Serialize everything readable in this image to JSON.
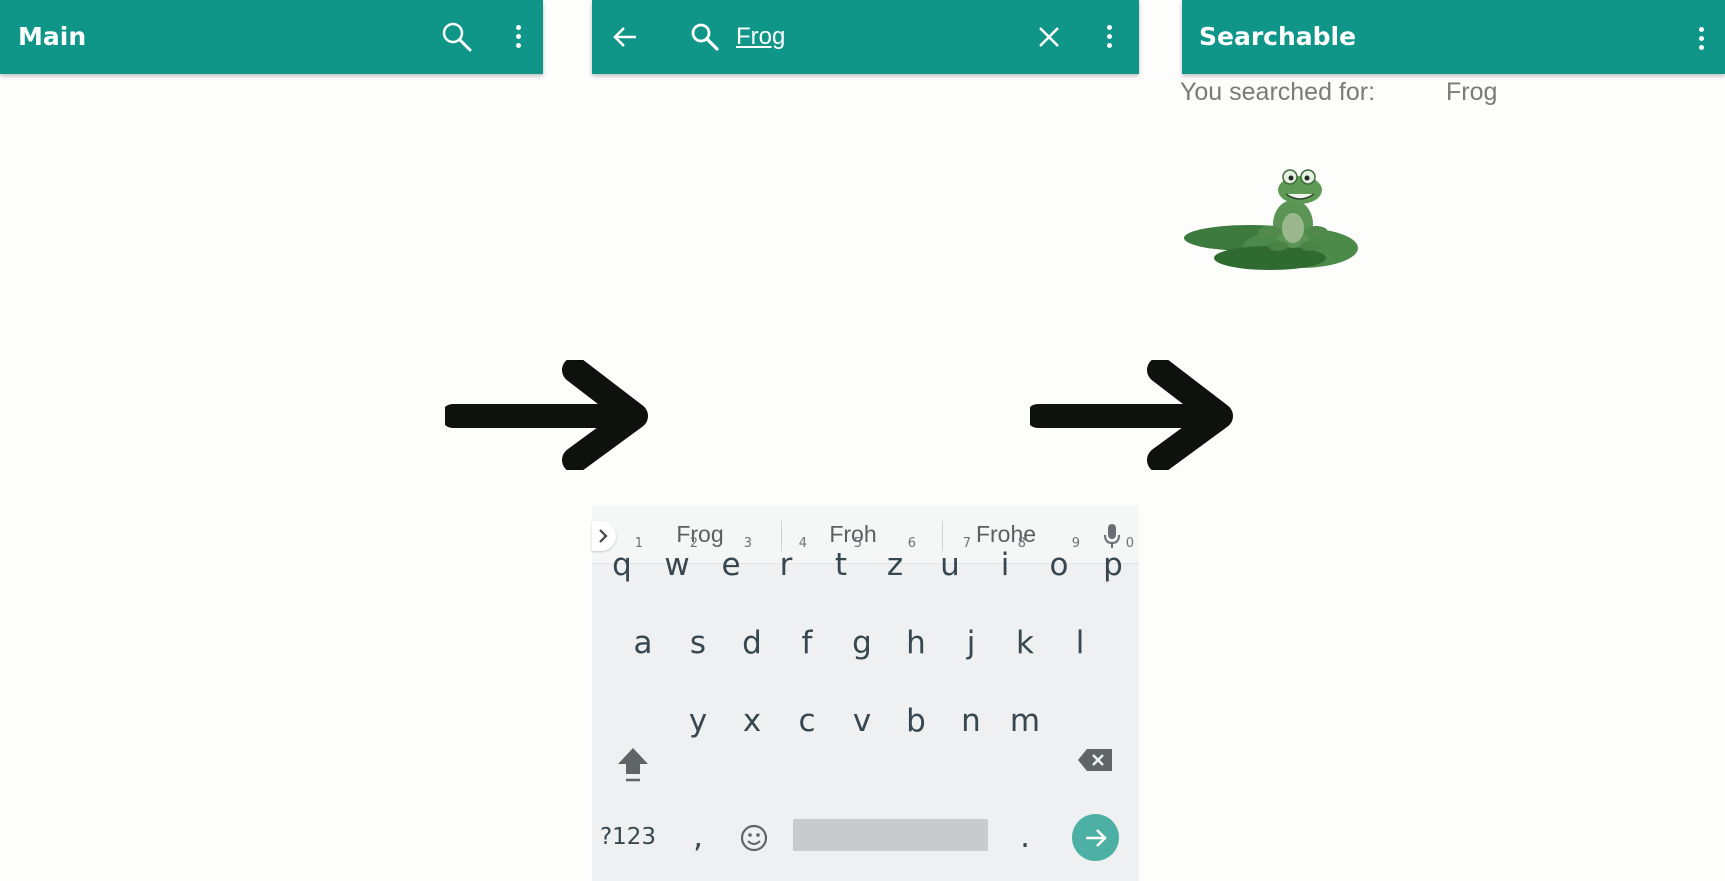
{
  "screens": {
    "main": {
      "title": "Main",
      "icons": [
        "search-icon",
        "more-vert-icon"
      ]
    },
    "search": {
      "query": "Frog",
      "icons": [
        "back-arrow-icon",
        "search-icon",
        "clear-icon",
        "more-vert-icon"
      ]
    },
    "searchable": {
      "title": "Searchable",
      "result_label": "You searched for:",
      "result_value": "Frog",
      "image": "frog-on-lily-pad"
    }
  },
  "keyboard": {
    "suggestions": [
      "Frog",
      "Froh",
      "Frohe"
    ],
    "row1": [
      {
        "k": "q",
        "h": "1"
      },
      {
        "k": "w",
        "h": "2"
      },
      {
        "k": "e",
        "h": "3"
      },
      {
        "k": "r",
        "h": "4"
      },
      {
        "k": "t",
        "h": "5"
      },
      {
        "k": "z",
        "h": "6"
      },
      {
        "k": "u",
        "h": "7"
      },
      {
        "k": "i",
        "h": "8"
      },
      {
        "k": "o",
        "h": "9"
      },
      {
        "k": "p",
        "h": "0"
      }
    ],
    "row2": [
      "a",
      "s",
      "d",
      "f",
      "g",
      "h",
      "j",
      "k",
      "l"
    ],
    "row3": [
      "y",
      "x",
      "c",
      "v",
      "b",
      "n",
      "m"
    ],
    "bottom": {
      "symbols": "?123",
      "comma": ",",
      "period": "."
    },
    "icons": [
      "chevron-right-icon",
      "mic-icon",
      "shift-icon",
      "backspace-icon",
      "emoji-icon",
      "enter-arrow-icon"
    ]
  },
  "colors": {
    "toolbar": "#0f9688",
    "enter_button": "#4db0a4",
    "keyboard_bg": "#eef0f1"
  }
}
